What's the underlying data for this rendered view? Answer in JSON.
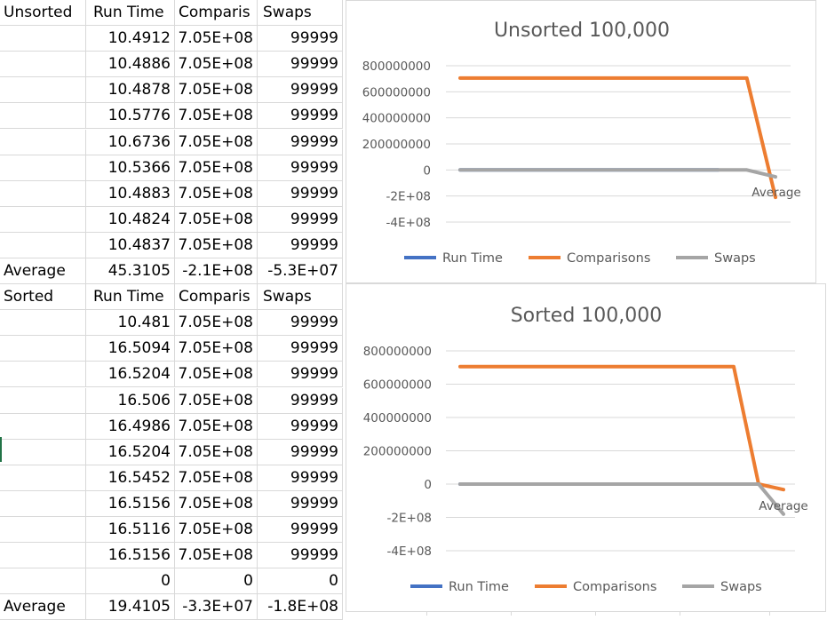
{
  "sheet": {
    "rows": [
      [
        "Unsorted",
        "Run Time",
        "Comparis",
        "Swaps"
      ],
      [
        "",
        "10.4912",
        "7.05E+08",
        "99999"
      ],
      [
        "",
        "10.4886",
        "7.05E+08",
        "99999"
      ],
      [
        "",
        "10.4878",
        "7.05E+08",
        "99999"
      ],
      [
        "",
        "10.5776",
        "7.05E+08",
        "99999"
      ],
      [
        "",
        "10.6736",
        "7.05E+08",
        "99999"
      ],
      [
        "",
        "10.5366",
        "7.05E+08",
        "99999"
      ],
      [
        "",
        "10.4883",
        "7.05E+08",
        "99999"
      ],
      [
        "",
        "10.4824",
        "7.05E+08",
        "99999"
      ],
      [
        "",
        "10.4837",
        "7.05E+08",
        "99999"
      ],
      [
        "Average",
        "45.3105",
        "-2.1E+08",
        "-5.3E+07"
      ],
      [
        "Sorted",
        "Run Time",
        "Comparis",
        "Swaps"
      ],
      [
        "",
        "10.481",
        "7.05E+08",
        "99999"
      ],
      [
        "",
        "16.5094",
        "7.05E+08",
        "99999"
      ],
      [
        "",
        "16.5204",
        "7.05E+08",
        "99999"
      ],
      [
        "",
        "16.506",
        "7.05E+08",
        "99999"
      ],
      [
        "",
        "16.4986",
        "7.05E+08",
        "99999"
      ],
      [
        "",
        "16.5204",
        "7.05E+08",
        "99999"
      ],
      [
        "",
        "16.5452",
        "7.05E+08",
        "99999"
      ],
      [
        "",
        "16.5156",
        "7.05E+08",
        "99999"
      ],
      [
        "",
        "16.5116",
        "7.05E+08",
        "99999"
      ],
      [
        "",
        "16.5156",
        "7.05E+08",
        "99999"
      ],
      [
        "",
        "0",
        "0",
        "0"
      ],
      [
        "Average",
        "19.4105",
        "-3.3E+07",
        "-1.8E+08"
      ]
    ]
  },
  "chart_data": [
    {
      "type": "line",
      "title": "Unsorted 100,000",
      "x": [
        "",
        "",
        "",
        "",
        "",
        "",
        "",
        "",
        "",
        "",
        "",
        "Average"
      ],
      "categories_label_shown": "Average",
      "ytick_labels": [
        "800000000",
        "600000000",
        "400000000",
        "200000000",
        "0",
        "-2E+08",
        "-4E+08"
      ],
      "ytick_values": [
        800000000,
        600000000,
        400000000,
        200000000,
        0,
        -200000000,
        -400000000
      ],
      "ylim": [
        -400000000,
        800000000
      ],
      "grid": true,
      "legend": "bottom",
      "series": [
        {
          "name": "Run Time",
          "color": "#4472C4",
          "values": [
            10.4912,
            10.4886,
            10.4878,
            10.5776,
            10.6736,
            10.5366,
            10.4883,
            10.4824,
            10.4837,
            45.3105
          ]
        },
        {
          "name": "Comparisons",
          "color": "#ED7D31",
          "values": [
            705000000,
            705000000,
            705000000,
            705000000,
            705000000,
            705000000,
            705000000,
            705000000,
            705000000,
            705000000,
            705000000,
            -210000000
          ]
        },
        {
          "name": "Swaps",
          "color": "#A5A5A5",
          "values": [
            99999,
            99999,
            99999,
            99999,
            99999,
            99999,
            99999,
            99999,
            99999,
            99999,
            99999,
            -53000000
          ]
        }
      ]
    },
    {
      "type": "line",
      "title": "Sorted 100,000",
      "x": [
        "",
        "",
        "",
        "",
        "",
        "",
        "",
        "",
        "",
        "",
        "",
        "",
        "Average"
      ],
      "categories_label_shown": "Average",
      "ytick_labels": [
        "800000000",
        "600000000",
        "400000000",
        "200000000",
        "0",
        "-2E+08",
        "-4E+08"
      ],
      "ytick_values": [
        800000000,
        600000000,
        400000000,
        200000000,
        0,
        -200000000,
        -400000000
      ],
      "ylim": [
        -400000000,
        800000000
      ],
      "grid": true,
      "legend": "bottom",
      "series": [
        {
          "name": "Run Time",
          "color": "#4472C4",
          "values": [
            10.481,
            16.5094,
            16.5204,
            16.506,
            16.4986,
            16.5204,
            16.5452,
            16.5156,
            16.5116,
            16.5156,
            0,
            19.4105
          ]
        },
        {
          "name": "Comparisons",
          "color": "#ED7D31",
          "values": [
            705000000,
            705000000,
            705000000,
            705000000,
            705000000,
            705000000,
            705000000,
            705000000,
            705000000,
            705000000,
            705000000,
            705000000,
            0,
            -33000000
          ]
        },
        {
          "name": "Swaps",
          "color": "#A5A5A5",
          "values": [
            99999,
            99999,
            99999,
            99999,
            99999,
            99999,
            99999,
            99999,
            99999,
            99999,
            99999,
            99999,
            0,
            -180000000
          ]
        }
      ]
    }
  ]
}
